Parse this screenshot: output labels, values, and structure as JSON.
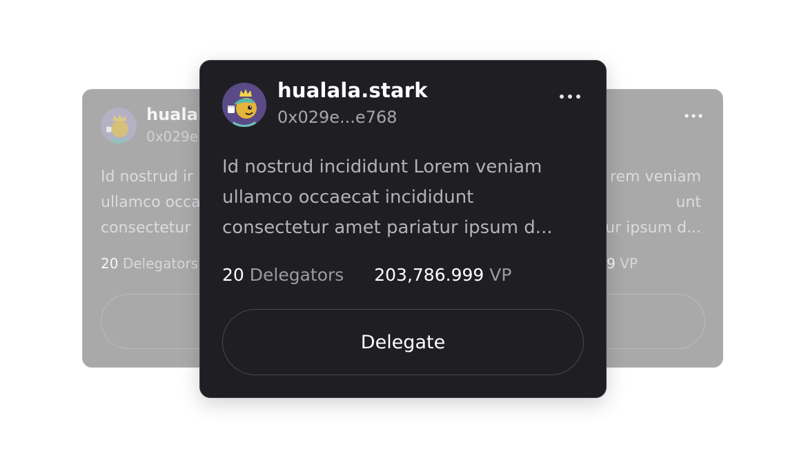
{
  "background_card": {
    "name": "hualala",
    "address": "0x029e",
    "description_lines": [
      "Id nostrud ir",
      "ullamco occa",
      "consectetur"
    ],
    "description_right_lines": [
      "rem veniam",
      "unt",
      "ur ipsum d..."
    ],
    "delegators_count": "20",
    "delegators_label": "Delegators",
    "vp_value_fragment": "9",
    "vp_label": "VP"
  },
  "card": {
    "name": "hualala.stark",
    "address": "0x029e...e768",
    "more_icon": "more-horizontal-icon",
    "description_lines": [
      "Id nostrud incididunt Lorem veniam",
      "ullamco occaecat incididunt",
      "consectetur amet pariatur ipsum d..."
    ],
    "delegators_count": "20",
    "delegators_label": "Delegators",
    "voting_power": "203,786.999",
    "voting_power_label": "VP",
    "delegate_label": "Delegate"
  },
  "colors": {
    "card_background": "#1f1e23",
    "background_card": "#a9a9aa",
    "muted_text": "#a7a6ac",
    "avatar_background": "#5a4a87"
  }
}
